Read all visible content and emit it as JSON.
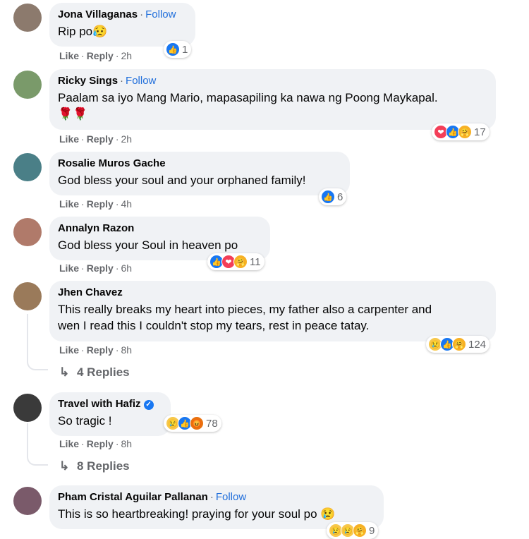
{
  "comments": [
    {
      "name": "Jona Villaganas",
      "follow": "Follow",
      "text": "Rip po😥",
      "like": "Like",
      "reply": "Reply",
      "time": "2h",
      "reactions": "1",
      "avatar_color": "#8c7a6d"
    },
    {
      "name": "Ricky Sings",
      "follow": "Follow",
      "text": "Paalam sa iyo Mang Mario, mapasapiling ka nawa ng Poong Maykapal.",
      "text2": "🌹🌹",
      "like": "Like",
      "reply": "Reply",
      "time": "2h",
      "reactions": "17",
      "avatar_color": "#7a9a6a"
    },
    {
      "name": "Rosalie Muros Gache",
      "text": "God bless your soul and your orphaned family!",
      "like": "Like",
      "reply": "Reply",
      "time": "4h",
      "reactions": "6",
      "avatar_color": "#4a7f87"
    },
    {
      "name": "Annalyn Razon",
      "text": "God bless your Soul in heaven po",
      "like": "Like",
      "reply": "Reply",
      "time": "6h",
      "reactions": "11",
      "avatar_color": "#b07a6a"
    },
    {
      "name": "Jhen Chavez",
      "text": "This really breaks my heart into pieces, my father also a carpenter and",
      "text2": "wen I read this I couldn't stop my tears, rest in peace tatay.",
      "like": "Like",
      "reply": "Reply",
      "time": "8h",
      "reactions": "124",
      "replies": "4 Replies",
      "avatar_color": "#9a7a5a"
    },
    {
      "name": "Travel with Hafiz",
      "text": "So tragic !",
      "like": "Like",
      "reply": "Reply",
      "time": "8h",
      "reactions": "78",
      "replies": "8 Replies",
      "avatar_color": "#3a3a3a"
    },
    {
      "name": "Pham Cristal Aguilar Pallanan",
      "follow": "Follow",
      "text": "This is so heartbreaking! praying for your soul po 😢",
      "like": "Like",
      "reply": "Reply",
      "time": "",
      "reactions": "9",
      "avatar_color": "#7a5a6a"
    }
  ],
  "icons": {
    "like": "👍",
    "love": "❤",
    "care": "🤗",
    "sad": "😢",
    "angry": "😡",
    "reply_arrow": "↳",
    "check": "✓"
  }
}
